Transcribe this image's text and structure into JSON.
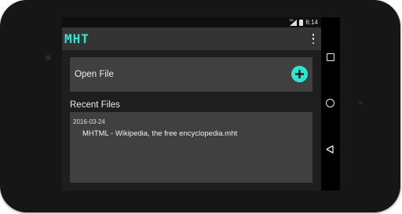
{
  "status": {
    "time": "6:14",
    "signal_label": "3G"
  },
  "app": {
    "title": "MHT"
  },
  "open_file": {
    "label": "Open File"
  },
  "recent": {
    "title": "Recent Files",
    "items": [
      {
        "date": "2016-03-24",
        "name": "MHTML - Wikipedia, the free encyclopedia.mht"
      }
    ]
  },
  "colors": {
    "accent": "#2de6d2",
    "card": "#404040",
    "appbar": "#343434"
  }
}
